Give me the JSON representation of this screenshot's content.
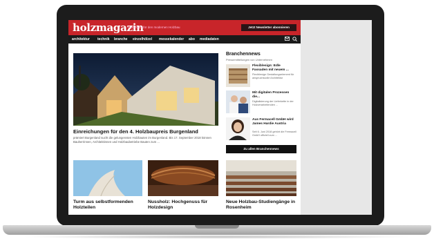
{
  "header": {
    "logo": "holzmagazin",
    "tagline": "Das Portal für den modernen Holzbau",
    "newsletter_button": "Jetzt Newsletter abonnieren"
  },
  "nav": {
    "items": [
      "architektur",
      "technik",
      "branche",
      "einzelhölzel",
      "messekalender",
      "abo",
      "mediadaten"
    ],
    "mail_icon": "mail-icon",
    "search_icon": "search-icon"
  },
  "hero": {
    "title": "Einreichungen für den 4. Holzbaupreis Burgenland",
    "text": "prämiert Burgenland sucht die gelungensten Holzbauten im Burgenland. Bis 17. September 2018 können Bauherrinnen, Architektinnen und Holzbaubetriebe Bauten zum ..."
  },
  "cards": [
    {
      "title": "Turm aus selbstformenden Holzteilen"
    },
    {
      "title": "Nussholz: Hochgenuss für Holzdesign"
    },
    {
      "title": "Neue Holzbau-Studiengänge in Rosenheim"
    }
  ],
  "sidebar": {
    "title": "Branchennews",
    "subtitle": "Pressemitteilungen von Unternehmen",
    "items": [
      {
        "title": "Flexiblesign: Edle Fassaden mit neuem ...",
        "text": "Flexiblesign Gestaltungselement für anspruchsvolle Architektur"
      },
      {
        "title": "Mit digitalen Prozessen die...",
        "text": "Digitalisierung der Lieferkette in der Holzverarbeitenden ..."
      },
      {
        "title": "Aus Fermacell GmbH wird James Hardie Austria",
        "text": "Seit 6. Juni 2018 gehört die Fermacell GmbH offiziell zum ..."
      }
    ],
    "button": "Zu allen Branchennews"
  },
  "colors": {
    "brand_red": "#c8252a",
    "nav_black": "#1a1a1a"
  }
}
